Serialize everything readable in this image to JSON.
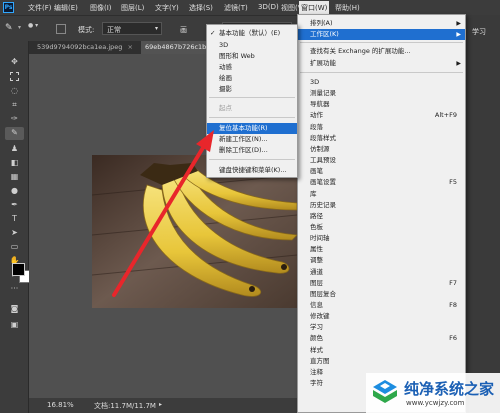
{
  "menubar": {
    "app_icon": "Ps",
    "items": [
      "文件(F)",
      "编辑(E)",
      "图像(I)",
      "图层(L)",
      "文字(Y)",
      "选择(S)",
      "滤镜(T)",
      "3D(D)",
      "视图(V)",
      "窗口(W)",
      "帮助(H)"
    ]
  },
  "options_bar": {
    "mode_label": "模式:",
    "mode_value": "正常",
    "extra_label": "画"
  },
  "tabs": [
    {
      "label": "539d9794092bca1ea.jpeg"
    },
    {
      "label": "69eb4867b726c1bf"
    }
  ],
  "status": {
    "zoom": "16.81%",
    "doc": "文档:11.7M/11.7M"
  },
  "right_panel": {
    "label": "学习"
  },
  "window_menu": {
    "items": [
      {
        "label": "排列(A)",
        "arrow": true
      },
      {
        "label": "工作区(K)",
        "arrow": true,
        "highlight": true
      },
      {
        "label": "查找有关 Exchange 的扩展功能..."
      },
      {
        "label": "扩展功能",
        "arrow": true
      },
      {
        "label": "3D"
      },
      {
        "label": "测量记录"
      },
      {
        "label": "导航器"
      },
      {
        "label": "动作",
        "shortcut": "Alt+F9"
      },
      {
        "label": "段落"
      },
      {
        "label": "段落样式"
      },
      {
        "label": "仿制源"
      },
      {
        "label": "工具预设"
      },
      {
        "label": "画笔"
      },
      {
        "label": "画笔设置",
        "shortcut": "F5"
      },
      {
        "label": "库"
      },
      {
        "label": "历史记录"
      },
      {
        "label": "路径"
      },
      {
        "label": "色板"
      },
      {
        "label": "时间轴"
      },
      {
        "label": "属性"
      },
      {
        "label": "调整"
      },
      {
        "label": "通道"
      },
      {
        "label": "图层",
        "shortcut": "F7"
      },
      {
        "label": "图层复合"
      },
      {
        "label": "信息",
        "shortcut": "F8"
      },
      {
        "label": "修改键"
      },
      {
        "label": "学习"
      },
      {
        "label": "颜色",
        "shortcut": "F6"
      },
      {
        "label": "样式"
      },
      {
        "label": "直方图"
      },
      {
        "label": "注释"
      },
      {
        "label": "字符"
      }
    ]
  },
  "workspace_menu": {
    "items": [
      {
        "label": "基本功能（默认）(E)",
        "checked": true
      },
      {
        "label": "3D"
      },
      {
        "label": "图形和 Web"
      },
      {
        "label": "动感"
      },
      {
        "label": "绘画"
      },
      {
        "label": "摄影"
      },
      {
        "label": "起点",
        "dim": true
      },
      {
        "label": "复位基本功能(R)",
        "highlight": true
      },
      {
        "label": "新建工作区(N)..."
      },
      {
        "label": "删除工作区(D)..."
      },
      {
        "label": "键盘快捷键和菜单(K)..."
      }
    ]
  },
  "watermark": {
    "title": "纯净系统之家",
    "url": "www.ycwjzy.com"
  },
  "colors": {
    "highlight": "#1f6fd0",
    "arrow": "#e8262b"
  }
}
